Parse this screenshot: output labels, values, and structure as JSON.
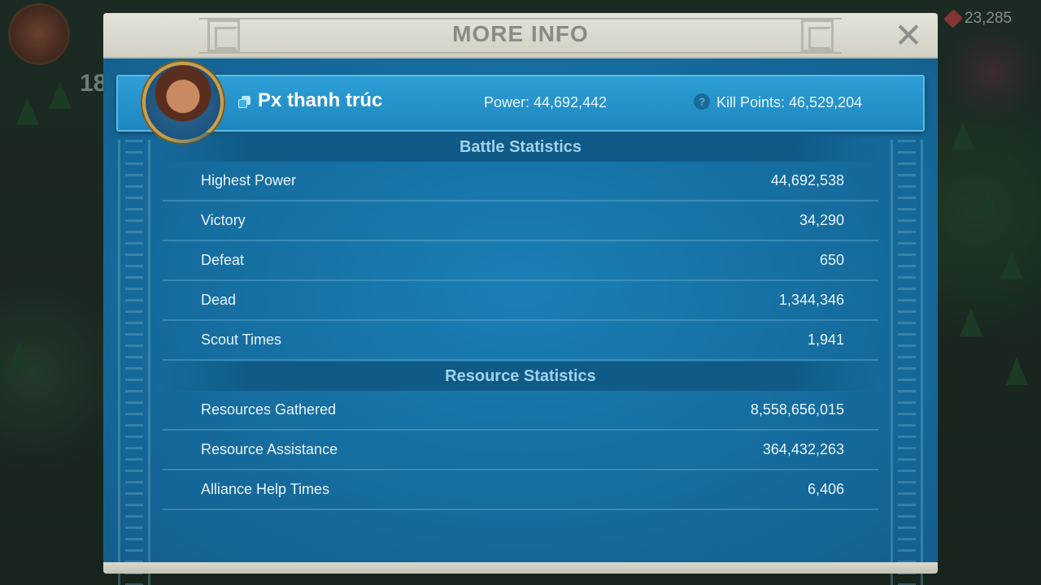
{
  "background": {
    "top_level_number": "18",
    "gem_count": "23,285"
  },
  "modal": {
    "title": "MORE INFO",
    "close_symbol": "✕"
  },
  "player": {
    "name": "Px thanh trúc",
    "power": "Power: 44,692,442",
    "kill_points": "Kill Points: 46,529,204",
    "help_symbol": "?"
  },
  "battle": {
    "header": "Battle Statistics",
    "rows": [
      {
        "label": "Highest Power",
        "value": "44,692,538"
      },
      {
        "label": "Victory",
        "value": "34,290"
      },
      {
        "label": "Defeat",
        "value": "650"
      },
      {
        "label": "Dead",
        "value": "1,344,346"
      },
      {
        "label": "Scout Times",
        "value": "1,941"
      }
    ]
  },
  "resource": {
    "header": "Resource Statistics",
    "rows": [
      {
        "label": "Resources Gathered",
        "value": "8,558,656,015"
      },
      {
        "label": "Resource Assistance",
        "value": "364,432,263"
      },
      {
        "label": "Alliance Help Times",
        "value": "6,406"
      }
    ]
  },
  "colors": {
    "panel_blue": "#1670a3",
    "banner_blue": "#2d9fd6",
    "header_cream": "#e6e3d8",
    "section_text": "#9fd2ee"
  }
}
